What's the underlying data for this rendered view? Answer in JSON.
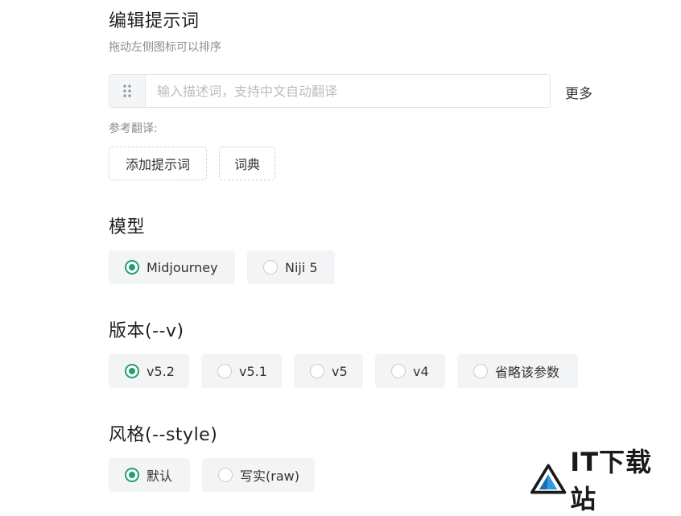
{
  "prompt_section": {
    "title": "编辑提示词",
    "subtitle": "拖动左侧图标可以排序",
    "input_placeholder": "输入描述词，支持中文自动翻译",
    "more_label": "更多",
    "translation_label": "参考翻译:",
    "add_prompt_label": "添加提示词",
    "dictionary_label": "词典"
  },
  "model_section": {
    "title": "模型",
    "options": [
      {
        "label": "Midjourney",
        "selected": true
      },
      {
        "label": "Niji 5",
        "selected": false
      }
    ]
  },
  "version_section": {
    "title": "版本(--v)",
    "options": [
      {
        "label": "v5.2",
        "selected": true
      },
      {
        "label": "v5.1",
        "selected": false
      },
      {
        "label": "v5",
        "selected": false
      },
      {
        "label": "v4",
        "selected": false
      },
      {
        "label": "省略该参数",
        "selected": false
      }
    ]
  },
  "style_section": {
    "title": "风格(--style)",
    "options": [
      {
        "label": "默认",
        "selected": true
      },
      {
        "label": "写实(raw)",
        "selected": false
      }
    ]
  },
  "watermark": {
    "text": "IT下载站"
  },
  "colors": {
    "accent": "#22a06b",
    "option_bg": "#f3f4f6"
  }
}
